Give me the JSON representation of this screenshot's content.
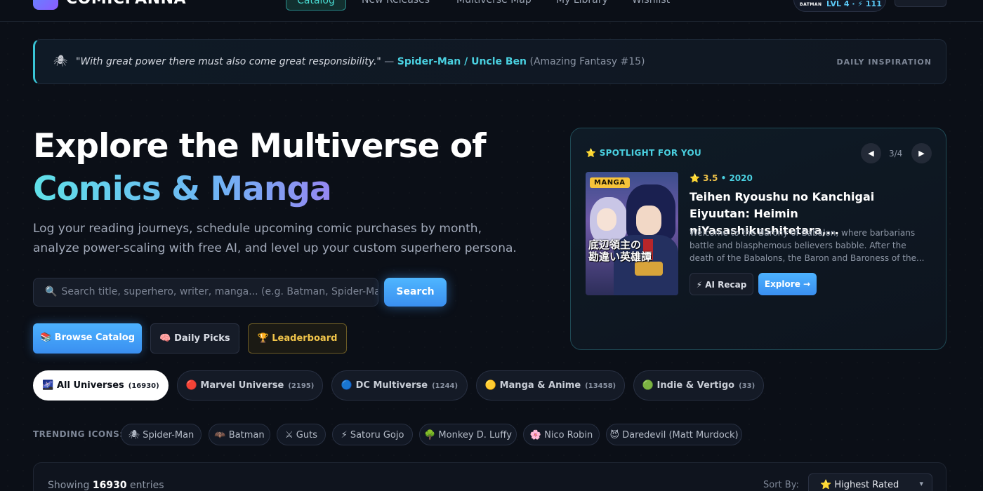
{
  "nav": {
    "brand": "COMICPANNA",
    "items": [
      "Catalog",
      "New Releases",
      "Multiverse Map",
      "My Library",
      "Wishlist"
    ],
    "level": "LVL 4 · ⚡ 111"
  },
  "quote": {
    "icon": "spider-icon",
    "text": "\"With great power there must also come great responsibility.\"",
    "dash": " — ",
    "hero": "Spider-Man / Uncle Ben",
    "source": " (Amazing Fantasy #15)",
    "label": "DAILY INSPIRATION"
  },
  "hero": {
    "line1": "Explore the Multiverse of",
    "line2": "Comics & Manga",
    "subtitle": "Log your reading journeys, schedule upcoming comic purchases by month, analyze power-scaling with free AI, and level up your custom superhero persona."
  },
  "search": {
    "placeholder": "Search title, superhero, writer, manga... (e.g. Batman, Spider-Ma",
    "button": "Search"
  },
  "actions": {
    "browse": "📚 Browse Catalog",
    "daily": "🧠 Daily Picks",
    "leaderboard": "🏆 Leaderboard"
  },
  "spotlight": {
    "label": "⭐ SPOTLIGHT FOR YOU",
    "page": "3/4",
    "badge": "MANGA",
    "cover_text": "底辺領主の\n勘違い英雄譚",
    "rating": "⭐ 3.5",
    "year": "2020",
    "title": "Teihen Ryoushu no Kanchigai Eiyuutan: Heimin niYasashikushitetara,...",
    "description": "Welcome to the Barony of Babalon, where barbarians battle and blasphemous believers babble. After the death of the Babalons, the Baron and Baroness of the...",
    "recap": "⚡ AI Recap",
    "explore": "Explore →"
  },
  "universes": [
    {
      "label": "🌌 All Universes",
      "count": "(16930)"
    },
    {
      "label": "🔴 Marvel Universe",
      "count": "(2195)"
    },
    {
      "label": "🔵 DC Multiverse",
      "count": "(1244)"
    },
    {
      "label": "🟡 Manga & Anime",
      "count": "(13458)"
    },
    {
      "label": "🟢 Indie & Vertigo",
      "count": "(33)"
    }
  ],
  "trending": {
    "label": "TRENDING ICONS:",
    "items": [
      "🕷 Spider-Man",
      "🦇 Batman",
      "⚔ Guts",
      "⚡ Satoru Gojo",
      "🌳 Monkey D. Luffy",
      "🌸 Nico Robin",
      "😈 Daredevil (Matt Murdock)"
    ]
  },
  "results": {
    "showing_prefix": "Showing ",
    "count": "16930",
    "showing_suffix": " entries",
    "sort_label": "Sort By:",
    "sort_value": "⭐ Highest Rated"
  }
}
